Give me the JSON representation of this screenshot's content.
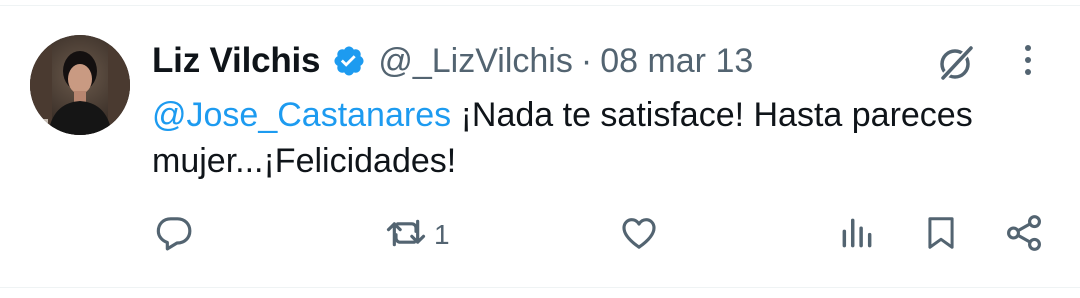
{
  "tweet": {
    "author_name": "Liz Vilchis",
    "handle": "@_LizVilchis",
    "separator": "·",
    "date": "08 mar 13",
    "mention": "@Jose_Castanares",
    "text": " ¡Nada te satisface! Hasta pareces mujer...¡Felicidades!"
  },
  "actions": {
    "retweet_count": "1"
  },
  "icons": {
    "verified": "verified-badge-icon",
    "grok": "grok-icon",
    "more": "more-vertical-icon",
    "reply": "reply-icon",
    "retweet": "retweet-icon",
    "like": "heart-icon",
    "views": "views-icon",
    "bookmark": "bookmark-icon",
    "share": "share-icon"
  },
  "colors": {
    "accent": "#1d9bf0",
    "text": "#0f1419",
    "muted": "#536471"
  }
}
